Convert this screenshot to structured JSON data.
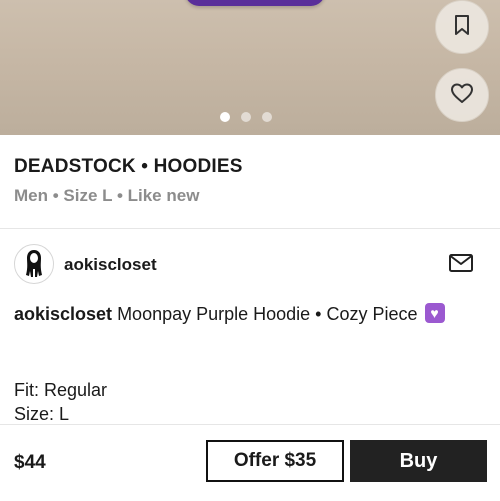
{
  "listing": {
    "category": "DEADSTOCK • HOODIES",
    "meta": "Men • Size L • Like new",
    "photo_count": 3,
    "active_photo": 1
  },
  "seller": {
    "username": "aokiscloset"
  },
  "description": {
    "username": "aokiscloset",
    "text": " Moonpay Purple Hoodie • Cozy Piece",
    "fit": "Fit: Regular",
    "size": "Size: L"
  },
  "footer": {
    "price": "$44",
    "offer_label": "Offer $35",
    "buy_label": "Buy"
  },
  "icons": {
    "save": "bookmark-icon",
    "like": "heart-icon",
    "message": "mail-icon",
    "emoji": "purple-heart-emoji"
  },
  "colors": {
    "garment": "#5a2f9a",
    "buy_button": "#222222",
    "meta_text": "#8c8c8c",
    "emoji": "#9b59d0"
  }
}
